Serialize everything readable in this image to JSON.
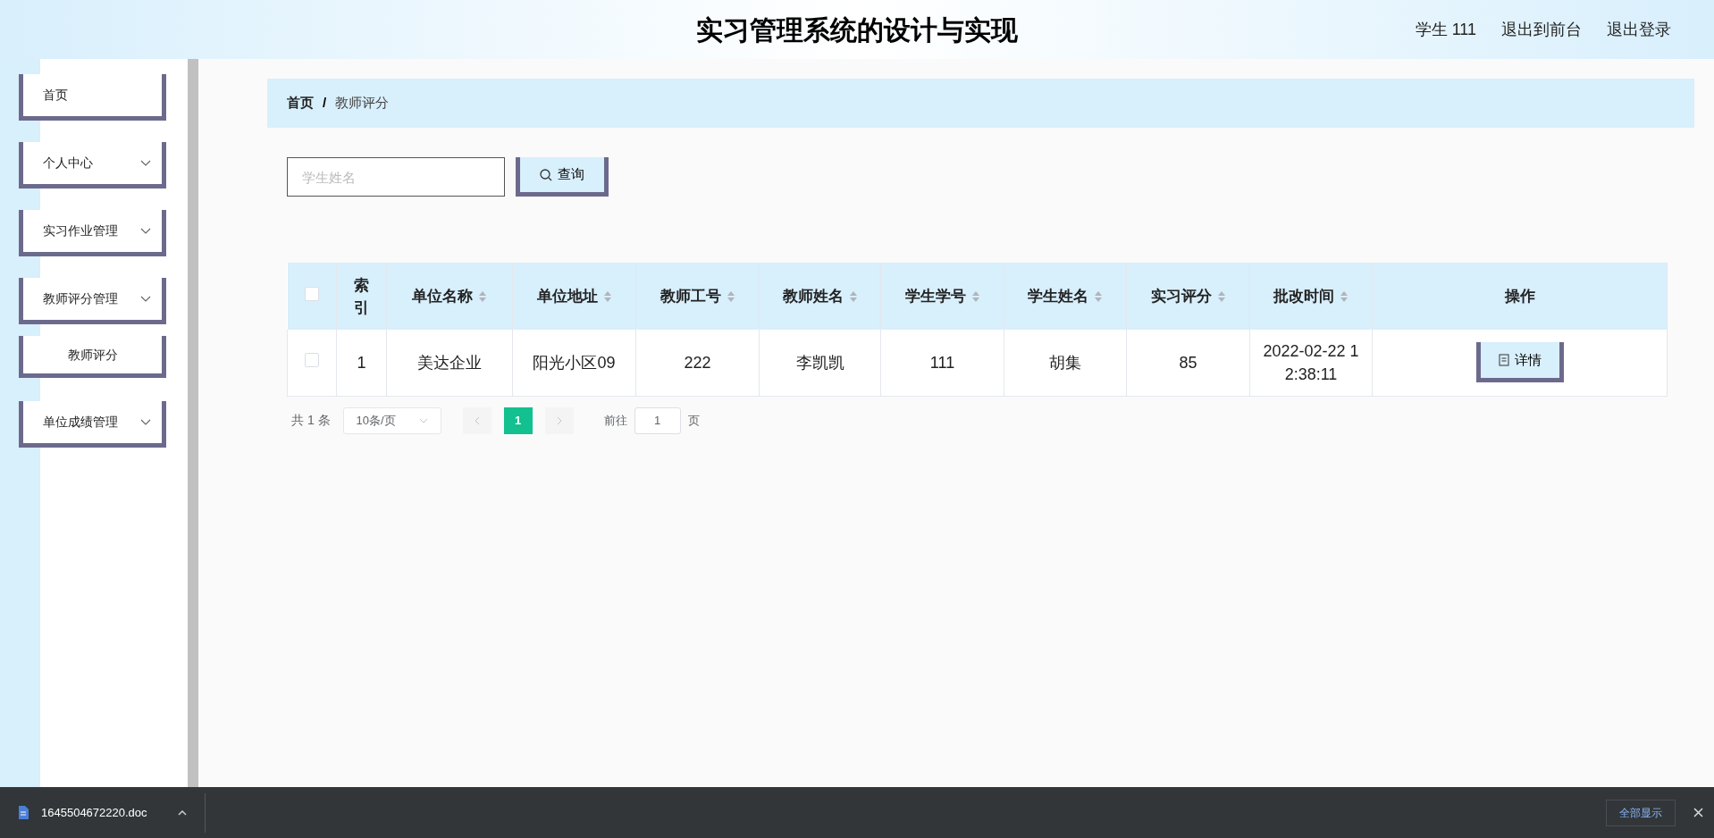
{
  "header": {
    "title": "实习管理系统的设计与实现",
    "links": [
      "学生 111",
      "退出到前台",
      "退出登录"
    ]
  },
  "sidebar": {
    "items": [
      {
        "label": "首页",
        "has_caret": false
      },
      {
        "label": "个人中心",
        "has_caret": true
      },
      {
        "label": "实习作业管理",
        "has_caret": true
      },
      {
        "label": "教师评分管理",
        "has_caret": true,
        "children": [
          {
            "label": "教师评分"
          }
        ]
      },
      {
        "label": "单位成绩管理",
        "has_caret": true
      }
    ]
  },
  "breadcrumb": {
    "items": [
      "首页",
      "教师评分"
    ],
    "separator": "/"
  },
  "search": {
    "placeholder": "学生姓名",
    "button": "查询"
  },
  "table": {
    "columns": [
      {
        "label": "索引",
        "sortable": false
      },
      {
        "label": "单位名称",
        "sortable": true
      },
      {
        "label": "单位地址",
        "sortable": true
      },
      {
        "label": "教师工号",
        "sortable": true
      },
      {
        "label": "教师姓名",
        "sortable": true
      },
      {
        "label": "学生学号",
        "sortable": true
      },
      {
        "label": "学生姓名",
        "sortable": true
      },
      {
        "label": "实习评分",
        "sortable": true
      },
      {
        "label": "批改时间",
        "sortable": true
      },
      {
        "label": "操作",
        "sortable": false
      }
    ],
    "header_checked": false,
    "rows": [
      {
        "checked": false,
        "cells": [
          "1",
          "美达企业",
          "阳光小区09",
          "222",
          "李凯凯",
          "111",
          "胡集",
          "85",
          "2022-02-22 12:38:11"
        ],
        "action": "详情"
      }
    ]
  },
  "pagination": {
    "total": "共 1 条",
    "page_size": "10条/页",
    "pages": [
      {
        "label": "1",
        "selected": true
      }
    ],
    "goto_label": "前往",
    "goto_value": "1",
    "goto_suffix": "页"
  },
  "download_bar": {
    "file": "1645504672220.doc",
    "show_all": "全部显示"
  }
}
